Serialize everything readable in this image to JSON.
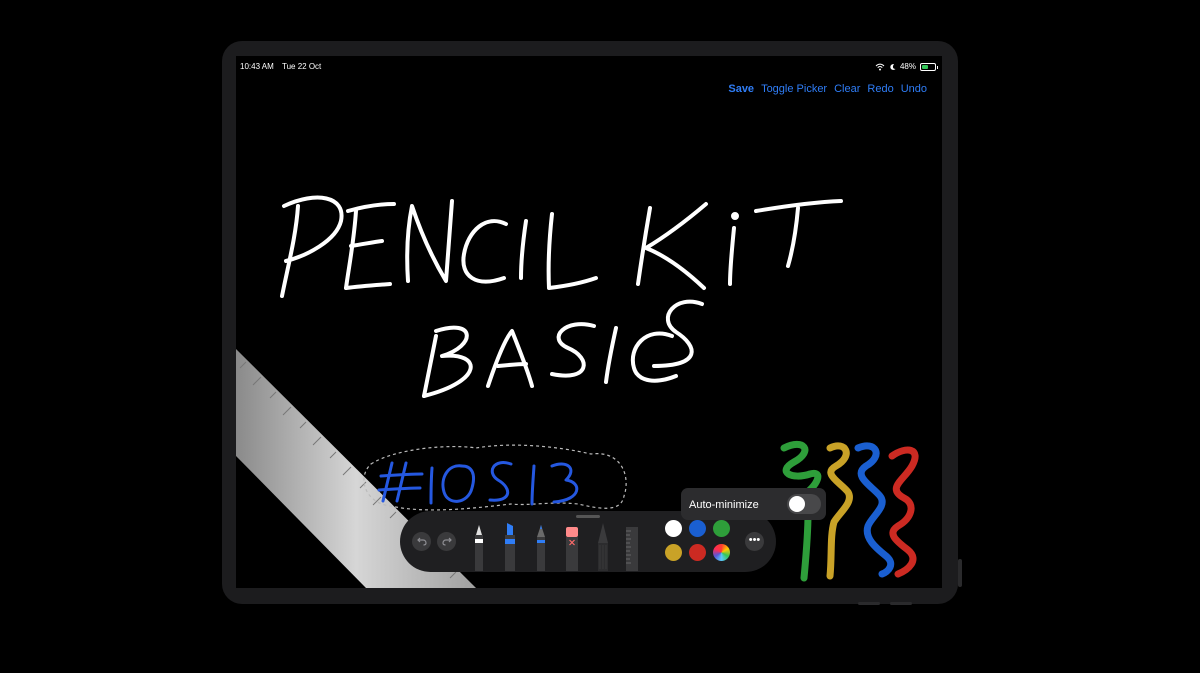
{
  "status_bar": {
    "time": "10:43 AM",
    "date": "Tue 22 Oct",
    "battery": "48%",
    "battery_level": 0.48
  },
  "nav": {
    "save": "Save",
    "toggle_picker": "Toggle Picker",
    "clear": "Clear",
    "redo": "Redo",
    "undo": "Undo"
  },
  "canvas": {
    "handwriting_line1": "PENCIL KIT",
    "handwriting_line2": "BASICS",
    "handwriting_tag": "#iOS13",
    "selection": "lasso selection around #iOS13"
  },
  "tool_picker": {
    "undo_icon": "undo-arrow",
    "redo_icon": "redo-arrow",
    "tools": [
      {
        "name": "pen",
        "color": "#ffffff"
      },
      {
        "name": "marker",
        "color": "#2f7df6"
      },
      {
        "name": "pencil",
        "color": "#2f7df6"
      },
      {
        "name": "eraser",
        "color": "#ff8a8a"
      },
      {
        "name": "lasso",
        "color": "#3a3a3c"
      },
      {
        "name": "ruler",
        "color": "#3a3a3c"
      }
    ],
    "colors": [
      "#ffffff",
      "#1a5fd1",
      "#2e9e3a",
      "#c9a227",
      "#cc2a22",
      "multicolor"
    ],
    "more_icon": "ellipsis"
  },
  "popover": {
    "label": "Auto-minimize",
    "toggle_on": false
  },
  "colors": {
    "accent": "#2f7df6",
    "toolbar": "#1f1f21",
    "device": "#1c1c1e"
  }
}
